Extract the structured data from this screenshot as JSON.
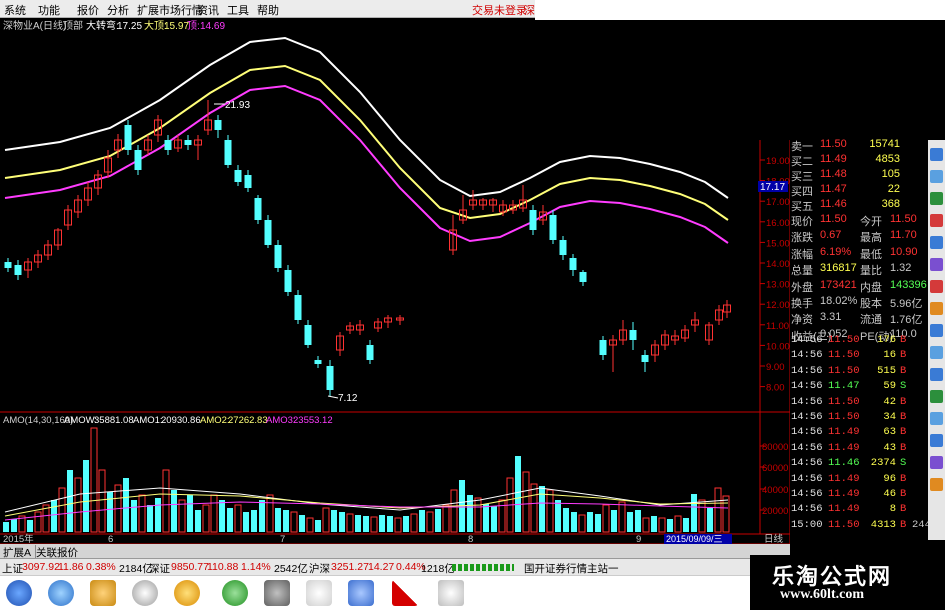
{
  "menu": {
    "items": [
      "系统",
      "功能",
      "报价",
      "分析",
      "扩展市场行情",
      "资讯",
      "工具",
      "帮助"
    ],
    "trade_login": "交易未登录",
    "right_cut": "深"
  },
  "indicator_header": {
    "stock_name": "深物业A(日线)",
    "indicator": "顶部",
    "line1_label": "大转弯:",
    "line1_value": "17.25",
    "line2_label": "大顶:",
    "line2_value": "15.97",
    "line3_label": "顶:",
    "line3_value": "14.69"
  },
  "price_annotations": {
    "high": "21.93",
    "low": "7.12",
    "current_tag": "17.17"
  },
  "price_axis": [
    "19.00",
    "18.00",
    "17.00",
    "16.00",
    "15.00",
    "14.00",
    "13.00",
    "12.00",
    "11.00",
    "10.00",
    "9.00",
    "8.00"
  ],
  "amo_header": {
    "title": "AMO(14,30,160)",
    "amow_label": "AMOW:",
    "amow": "35881.08",
    "amo1_label": "AMO1:",
    "amo1": "20930.86",
    "amo2_label": "AMO2:",
    "amo2": "27262.83",
    "amo3_label": "AMO3:",
    "amo3": "23553.12"
  },
  "volume_axis": [
    "80000",
    "60000",
    "40000",
    "20000"
  ],
  "date_axis": [
    "2015年",
    "6",
    "7",
    "8",
    "9"
  ],
  "selected_date": "2015/09/09/三",
  "period_label": "日线",
  "quote": {
    "order_book": [
      {
        "label": "卖一",
        "price": "11.50",
        "vol": "15741"
      },
      {
        "label": "买二",
        "price": "11.49",
        "vol": "4853"
      },
      {
        "label": "买三",
        "price": "11.48",
        "vol": "105"
      },
      {
        "label": "买四",
        "price": "11.47",
        "vol": "22"
      },
      {
        "label": "买五",
        "price": "11.46",
        "vol": "368"
      }
    ],
    "stats": [
      {
        "l1": "现价",
        "v1": "11.50",
        "l2": "今开",
        "v2": "11.50"
      },
      {
        "l1": "涨跌",
        "v1": "0.67",
        "l2": "最高",
        "v2": "11.70"
      },
      {
        "l1": "涨幅",
        "v1": "6.19%",
        "l2": "最低",
        "v2": "10.90"
      },
      {
        "l1": "总量",
        "v1": "316817",
        "l2": "量比",
        "v2": "1.32"
      },
      {
        "l1": "外盘",
        "v1": "173421",
        "l2": "内盘",
        "v2": "143396"
      },
      {
        "l1": "换手",
        "v1": "18.02%",
        "l2": "股本",
        "v2": "5.96亿"
      },
      {
        "l1": "净资",
        "v1": "3.31",
        "l2": "流通",
        "v2": "1.76亿"
      },
      {
        "l1": "收益(二)",
        "v1": "0.052",
        "l2": "PE(动)",
        "v2": "110.0"
      }
    ]
  },
  "ticks": [
    {
      "t": "14:56",
      "p": "11.50",
      "v": "176",
      "s": "B"
    },
    {
      "t": "14:56",
      "p": "11.50",
      "v": "16",
      "s": "B"
    },
    {
      "t": "14:56",
      "p": "11.50",
      "v": "515",
      "s": "B"
    },
    {
      "t": "14:56",
      "p": "11.47",
      "v": "59",
      "s": "S"
    },
    {
      "t": "14:56",
      "p": "11.50",
      "v": "42",
      "s": "B"
    },
    {
      "t": "14:56",
      "p": "11.50",
      "v": "34",
      "s": "B"
    },
    {
      "t": "14:56",
      "p": "11.49",
      "v": "63",
      "s": "B"
    },
    {
      "t": "14:56",
      "p": "11.49",
      "v": "43",
      "s": "B"
    },
    {
      "t": "14:56",
      "p": "11.46",
      "v": "2374",
      "s": "S"
    },
    {
      "t": "14:56",
      "p": "11.49",
      "v": "96",
      "s": "B"
    },
    {
      "t": "14:56",
      "p": "11.49",
      "v": "46",
      "s": "B"
    },
    {
      "t": "14:56",
      "p": "11.49",
      "v": "8",
      "s": "B"
    },
    {
      "t": "15:00",
      "p": "11.50",
      "v": "4313",
      "s": "B"
    }
  ],
  "tick_extra": "244",
  "tabs": [
    "扩展A",
    "关联报价"
  ],
  "status": {
    "sh_label": "上证",
    "sh_val": "3097.92",
    "sh_chg": "11.86",
    "sh_pct": "0.38%",
    "sh_amt": "2184亿",
    "sz_label": "深证",
    "sz_val": "9850.77",
    "sz_chg": "110.88",
    "sz_pct": "1.14%",
    "sz_amt": "2542亿",
    "hs_label": "沪深",
    "hs_val": "3251.27",
    "hs_chg": "14.27",
    "hs_pct": "0.44%",
    "hs_amt": "1218亿",
    "site": "国开证券行情主站一"
  },
  "watermark": {
    "title": "乐淘公式网",
    "url": "www.60lt.com"
  },
  "colors": {
    "up": "#ff3232",
    "down": "#54ffff",
    "ma1": "#ffffff",
    "ma2": "#ffff78",
    "ma3": "#ff3cff",
    "axis": "#c80000"
  }
}
